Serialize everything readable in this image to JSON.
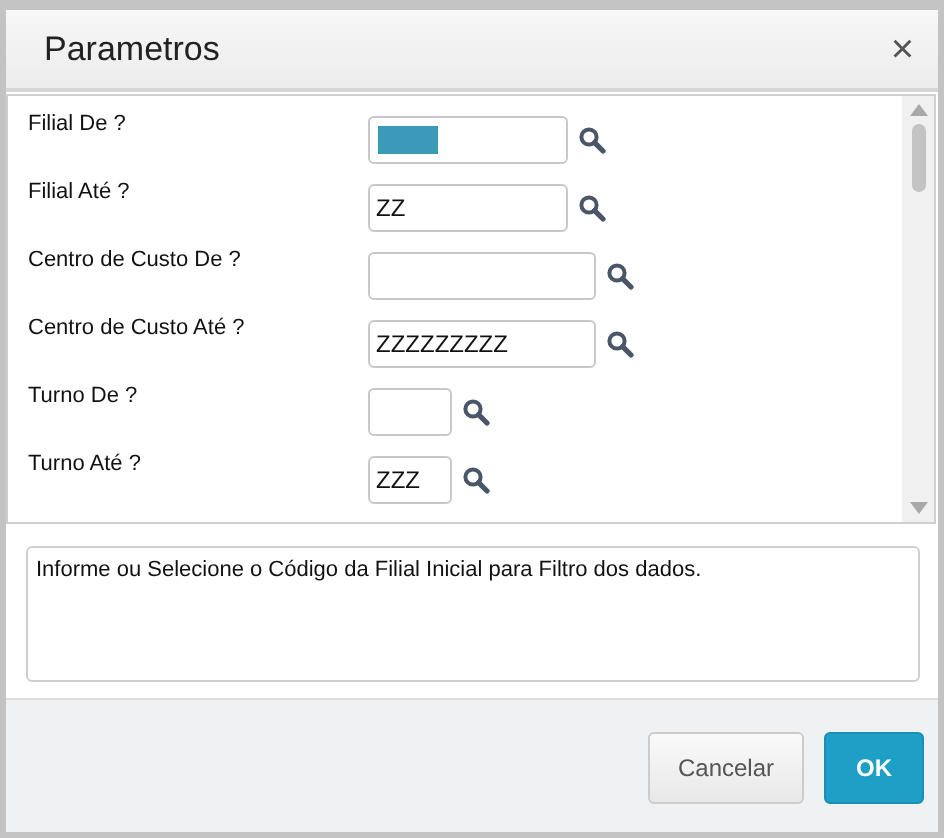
{
  "window": {
    "title": "Parametros",
    "close": "×"
  },
  "parameters": [
    {
      "label": "Filial De ?",
      "focused": true
    },
    {
      "label": "Filial Até ?",
      "value": "ZZ",
      "focused": false
    },
    {
      "label": "Centro de Custo De ?",
      "focused": false
    },
    {
      "label": "Centro de Custo Até ?",
      "value": "ZZZZZZZZZ",
      "focused": false
    },
    {
      "label": "Turno De ?",
      "focused": false
    },
    {
      "label": "Turno Até ?",
      "value": "ZZZ",
      "focused": false
    }
  ],
  "help": "Informe ou Selecione o Código da Filial Inicial para Filtro dos dados.",
  "buttons": [
    {
      "label": "Cancelar",
      "kind": "secondary"
    },
    {
      "label": "OK",
      "kind": "primary"
    }
  ]
}
